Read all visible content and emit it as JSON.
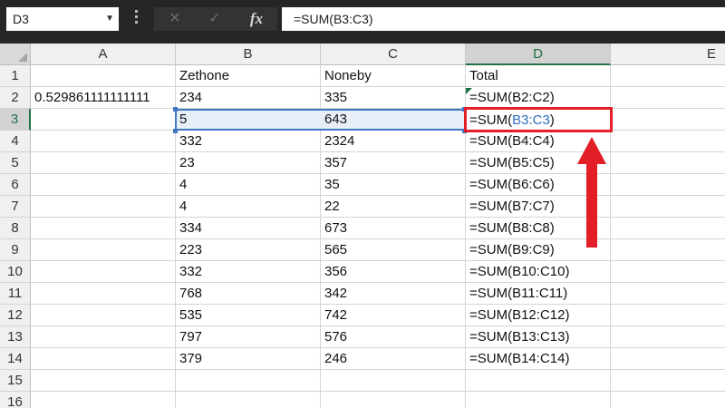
{
  "name_box": {
    "value": "D3"
  },
  "formula_bar": {
    "cancel_symbol": "✕",
    "enter_symbol": "✓",
    "fx_label": "fx",
    "formula": "=SUM(B3:C3)"
  },
  "columns": [
    "A",
    "B",
    "C",
    "D",
    "E"
  ],
  "rows": [
    "1",
    "2",
    "3",
    "4",
    "5",
    "6",
    "7",
    "8",
    "9",
    "10",
    "11",
    "12",
    "13",
    "14",
    "15",
    "16"
  ],
  "selected": {
    "column": "D",
    "row": "3"
  },
  "cells": {
    "A2": "0.529861111111111",
    "B1": "Zethone",
    "C1": "Noneby",
    "D1": "Total",
    "B2": "234",
    "C2": "335",
    "D2": "=SUM(B2:C2)",
    "B3": "5",
    "C3": "643",
    "D3_prefix": "=SUM(",
    "D3_ref": "B3:C3",
    "D3_suffix": ")",
    "B4": "332",
    "C4": "2324",
    "D4": "=SUM(B4:C4)",
    "B5": "23",
    "C5": "357",
    "D5": "=SUM(B5:C5)",
    "B6": "4",
    "C6": "35",
    "D6": "=SUM(B6:C6)",
    "B7": "4",
    "C7": "22",
    "D7": "=SUM(B7:C7)",
    "B8": "334",
    "C8": "673",
    "D8": "=SUM(B8:C8)",
    "B9": "223",
    "C9": "565",
    "D9": "=SUM(B9:C9)",
    "B10": "332",
    "C10": "356",
    "D10": "=SUM(B10:C10)",
    "B11": "768",
    "C11": "342",
    "D11": "=SUM(B11:C11)",
    "B12": "535",
    "C12": "742",
    "D12": "=SUM(B12:C12)",
    "B13": "797",
    "C13": "576",
    "D13": "=SUM(B13:C13)",
    "B14": "379",
    "C14": "246",
    "D14": "=SUM(B14:C14)"
  },
  "colors": {
    "selection": "#217346",
    "range_highlight": "#3f77c3",
    "annotation": "#e21e26"
  }
}
